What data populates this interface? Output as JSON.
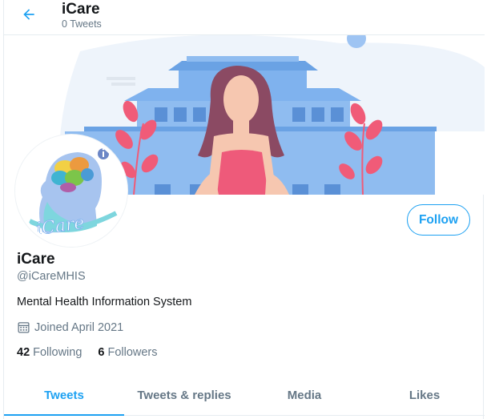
{
  "header": {
    "title": "iCare",
    "tweet_count": "0 Tweets"
  },
  "profile": {
    "name": "iCare",
    "handle": "@iCareMHIS",
    "bio": "Mental Health Information System",
    "joined": "Joined April 2021",
    "following_count": "42",
    "following_label": "Following",
    "followers_count": "6",
    "followers_label": "Followers",
    "follow_label": "Follow",
    "avatar_logo_text": "iCare"
  },
  "tabs": [
    {
      "label": "Tweets",
      "active": true
    },
    {
      "label": "Tweets & replies",
      "active": false
    },
    {
      "label": "Media",
      "active": false
    },
    {
      "label": "Likes",
      "active": false
    }
  ],
  "colors": {
    "accent": "#1da1f2",
    "muted": "#657786",
    "banner_blue": "#7fb2ee",
    "banner_pink": "#f05b78"
  },
  "icons": {
    "back": "arrow-left-icon",
    "calendar": "calendar-icon"
  }
}
